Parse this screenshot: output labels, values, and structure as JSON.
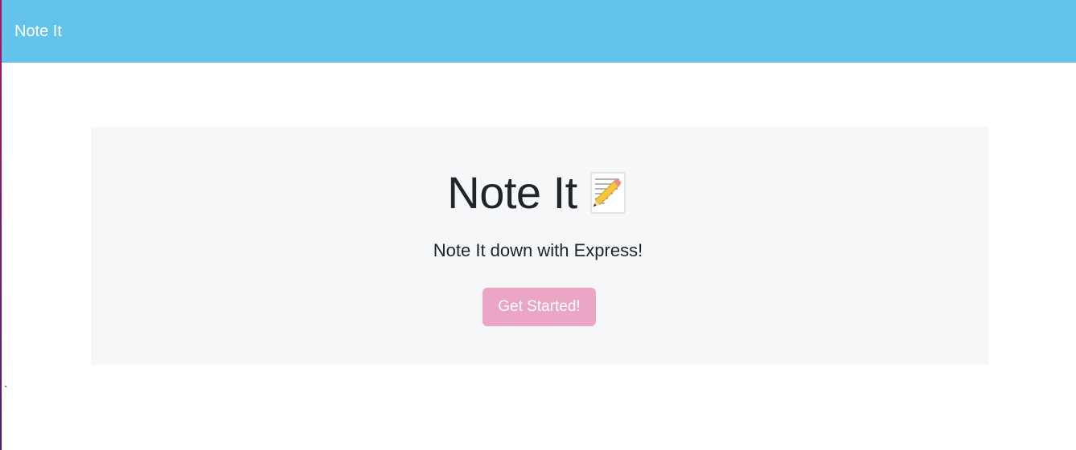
{
  "navbar": {
    "brand": "Note It"
  },
  "hero": {
    "title": "Note It",
    "icon": "memo-icon",
    "subtitle": "Note It down with Express!",
    "cta_label": "Get Started!"
  },
  "stray_text": "`",
  "colors": {
    "navbar": "#63c3ed",
    "hero_bg": "#f6f7f9",
    "cta_bg": "#eca6c5"
  }
}
